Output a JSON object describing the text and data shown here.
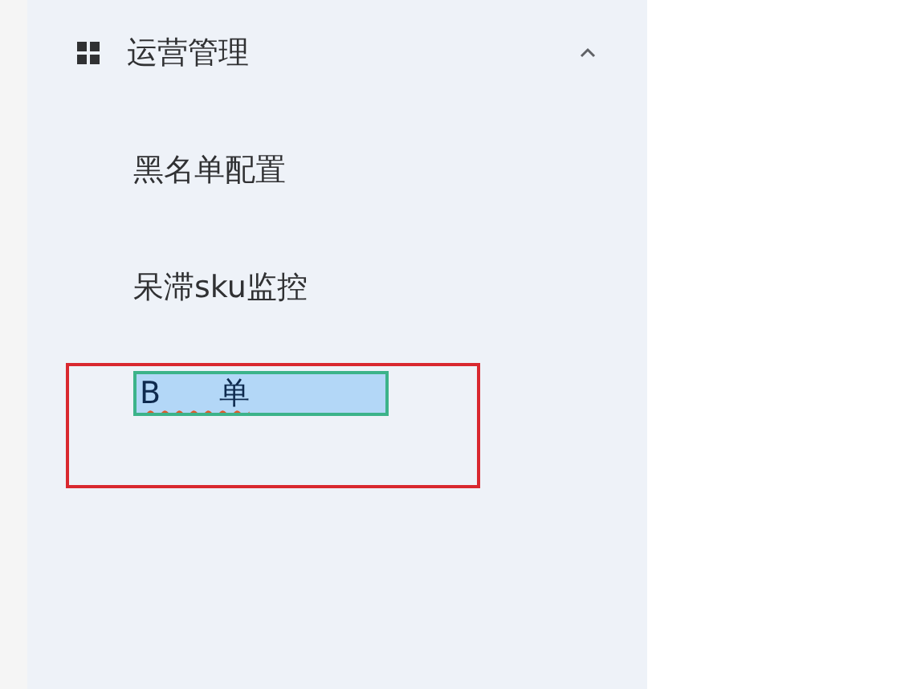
{
  "menu_group": {
    "title": "运营管理",
    "expanded": true,
    "items": [
      {
        "kind": "link",
        "label": "黑名单配置",
        "highlighted": false
      },
      {
        "kind": "link",
        "label": "呆滞sku监控",
        "highlighted": false
      },
      {
        "kind": "editing",
        "value": "B      单",
        "highlighted": true
      }
    ]
  }
}
